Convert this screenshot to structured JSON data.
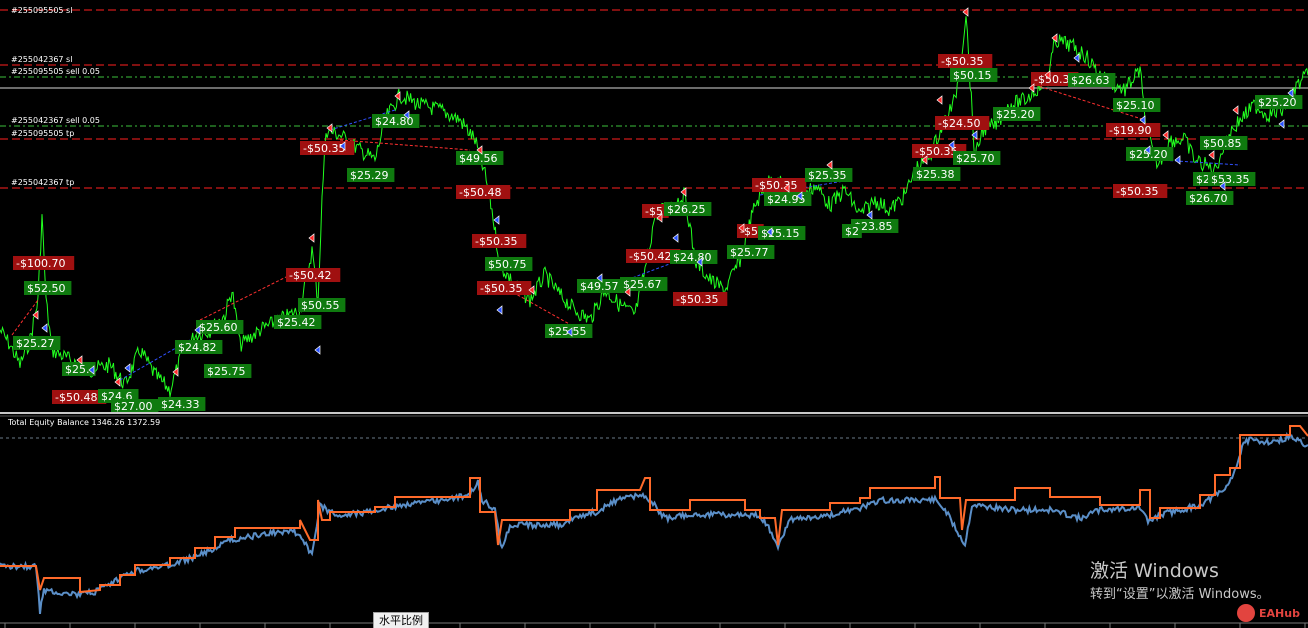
{
  "colors": {
    "background": "#000000",
    "price_line": "#21ff1f",
    "profit_tag": "#0f7a0f",
    "loss_tag": "#a01010",
    "red_level": "#ff2020",
    "green_level": "#3cbf3c",
    "equity_line": "#5b8fc8",
    "balance_line": "#ff6a2a",
    "separator": "#c8c8c8"
  },
  "main_chart": {
    "level_labels": [
      {
        "text": "#255095505 sl",
        "color": "red"
      },
      {
        "text": "#255042367 sl",
        "color": "red"
      },
      {
        "text": "#255095505 sell 0.05",
        "color": "green"
      },
      {
        "text": "#255042367 sell 0.05",
        "color": "green"
      },
      {
        "text": "#255095505 tp",
        "color": "red"
      },
      {
        "text": "#255042367 tp",
        "color": "red"
      }
    ],
    "trade_tags": [
      {
        "text": "-$100.70",
        "kind": "loss"
      },
      {
        "text": "$52.50",
        "kind": "profit"
      },
      {
        "text": "$25.27",
        "kind": "profit"
      },
      {
        "text": "$25.",
        "kind": "profit"
      },
      {
        "text": "-$50.48",
        "kind": "loss"
      },
      {
        "text": "$24.6",
        "kind": "profit"
      },
      {
        "text": "$27.00",
        "kind": "profit"
      },
      {
        "text": "$24.33",
        "kind": "profit"
      },
      {
        "text": "$24.82",
        "kind": "profit"
      },
      {
        "text": "$25.75",
        "kind": "profit"
      },
      {
        "text": "$25.60",
        "kind": "profit"
      },
      {
        "text": "$25.42",
        "kind": "profit"
      },
      {
        "text": "-$50.42",
        "kind": "loss"
      },
      {
        "text": "$50.55",
        "kind": "profit"
      },
      {
        "text": "-$50.35",
        "kind": "loss"
      },
      {
        "text": "$24.80",
        "kind": "profit"
      },
      {
        "text": "$25.29",
        "kind": "profit"
      },
      {
        "text": "$49.56",
        "kind": "profit"
      },
      {
        "text": "-$50.48",
        "kind": "loss"
      },
      {
        "text": "-$50.35",
        "kind": "loss"
      },
      {
        "text": "$50.75",
        "kind": "profit"
      },
      {
        "text": "-$50.35",
        "kind": "loss"
      },
      {
        "text": "$25.55",
        "kind": "profit"
      },
      {
        "text": "$49.57",
        "kind": "profit"
      },
      {
        "text": "$25.67",
        "kind": "profit"
      },
      {
        "text": "-$50.42",
        "kind": "loss"
      },
      {
        "text": "-$5",
        "kind": "loss"
      },
      {
        "text": "$26.25",
        "kind": "profit"
      },
      {
        "text": "$24.80",
        "kind": "profit"
      },
      {
        "text": "-$50.35",
        "kind": "loss"
      },
      {
        "text": "$25.77",
        "kind": "profit"
      },
      {
        "text": "-$5",
        "kind": "loss"
      },
      {
        "text": "$25.15",
        "kind": "profit"
      },
      {
        "text": "-$50.35",
        "kind": "loss"
      },
      {
        "text": "$24.95",
        "kind": "profit"
      },
      {
        "text": "$25.35",
        "kind": "profit"
      },
      {
        "text": "$23.85",
        "kind": "profit"
      },
      {
        "text": "$2",
        "kind": "profit"
      },
      {
        "text": "$25.38",
        "kind": "profit"
      },
      {
        "text": "-$50.35",
        "kind": "loss"
      },
      {
        "text": "-$24.50",
        "kind": "loss"
      },
      {
        "text": "$25.70",
        "kind": "profit"
      },
      {
        "text": "-$50.35",
        "kind": "loss"
      },
      {
        "text": "$50.15",
        "kind": "profit"
      },
      {
        "text": "$25.20",
        "kind": "profit"
      },
      {
        "text": "-$50.3",
        "kind": "loss"
      },
      {
        "text": "$26.63",
        "kind": "profit"
      },
      {
        "text": "$25.10",
        "kind": "profit"
      },
      {
        "text": "-$19.90",
        "kind": "loss"
      },
      {
        "text": "$25.20",
        "kind": "profit"
      },
      {
        "text": "-$50.35",
        "kind": "loss"
      },
      {
        "text": "$25.07",
        "kind": "profit"
      },
      {
        "text": "$50.85",
        "kind": "profit"
      },
      {
        "text": "$53.35",
        "kind": "profit"
      },
      {
        "text": "$26.70",
        "kind": "profit"
      },
      {
        "text": "$25.20",
        "kind": "profit"
      }
    ]
  },
  "sub_chart": {
    "title": "Total Equity Balance 1346.26 1372.59"
  },
  "watermark": {
    "line1": "激活 Windows",
    "line2": "转到“设置”以激活 Windows。"
  },
  "logo": {
    "text": "EAHub",
    "icon": "eahub-logo-icon"
  },
  "scale_button": {
    "label": "水平比例"
  }
}
